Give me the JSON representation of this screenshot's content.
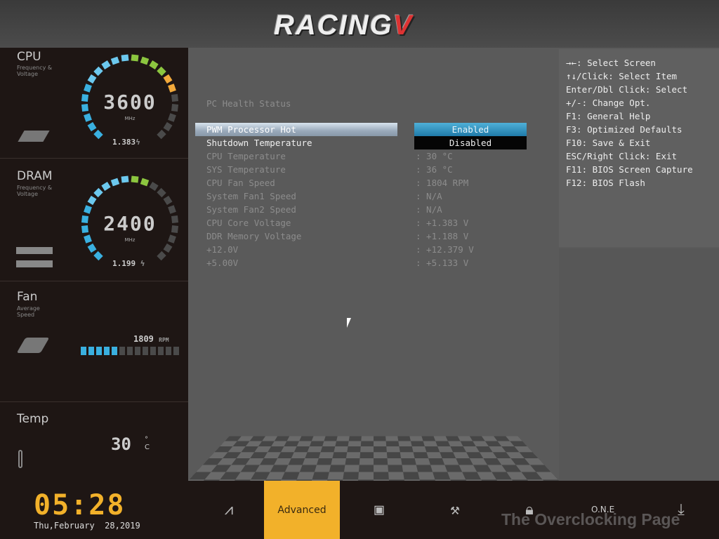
{
  "header": {
    "logo": "RACING",
    "logo_mark": "V"
  },
  "sidebar": {
    "cpu": {
      "title": "CPU",
      "subtitle": "Frequency & Voltage",
      "value": "3600",
      "unit": "MHz",
      "voltage": "1.383",
      "gauge_level": 0.77,
      "gauge_colors": [
        "#3ab0e0",
        "#8cc63f",
        "#f2a93b"
      ]
    },
    "dram": {
      "title": "DRAM",
      "subtitle": "Frequency & Voltage",
      "value": "2400",
      "unit": "MHz",
      "voltage": "1.199",
      "gauge_level": 0.59
    },
    "fan": {
      "title": "Fan",
      "subtitle": "Average Speed",
      "value": "1809",
      "unit": "RPM",
      "bar_level": 0.385
    },
    "temp": {
      "title": "Temp",
      "value": "30",
      "unit": "°C"
    }
  },
  "main": {
    "section_title": "PC Health Status",
    "items": [
      {
        "label": "PWM Processor Hot",
        "value": ""
      },
      {
        "label": "Shutdown Temperature",
        "value": ""
      },
      {
        "label": "CPU Temperature",
        "value": ": 30 °C"
      },
      {
        "label": "SYS Temperature",
        "value": ": 36 °C"
      },
      {
        "label": "CPU Fan Speed",
        "value": ": 1804 RPM"
      },
      {
        "label": "System Fan1 Speed",
        "value": ": N/A"
      },
      {
        "label": "System Fan2 Speed",
        "value": ": N/A"
      },
      {
        "label": "CPU Core Voltage",
        "value": ": +1.383 V"
      },
      {
        "label": "DDR Memory Voltage",
        "value": ": +1.188 V"
      },
      {
        "label": "+12.0V",
        "value": ": +12.379 V"
      },
      {
        "label": "+5.00V",
        "value": ": +5.133 V"
      }
    ],
    "dropdown": {
      "options": [
        "Enabled",
        "Disabled"
      ],
      "selected": "Enabled"
    }
  },
  "help": [
    "→←: Select Screen",
    "↑↓/Click: Select Item",
    "Enter/Dbl Click: Select",
    "+/-: Change Opt.",
    "F1: General Help",
    "F3: Optimized Defaults",
    "F10: Save & Exit",
    "ESC/Right Click: Exit",
    "F11: BIOS Screen Capture",
    "F12: BIOS Flash"
  ],
  "bottom": {
    "time": "05:28",
    "date": "Thu,February  28,2019",
    "tabs": [
      {
        "name": "main",
        "icon": "chart-icon"
      },
      {
        "name": "Advanced",
        "label": "Advanced"
      },
      {
        "name": "chipset",
        "icon": "chip-icon"
      },
      {
        "name": "tools",
        "icon": "wrench-icon"
      },
      {
        "name": "security",
        "icon": "lock-icon"
      },
      {
        "name": "one",
        "label": "O.N.E"
      },
      {
        "name": "exit",
        "icon": "download-icon"
      }
    ],
    "watermark": "The Overclocking Page"
  },
  "colors": {
    "accent": "#f2b12a",
    "gauge_blue": "#3ab0e0",
    "gauge_green": "#8cc63f",
    "gauge_orange": "#f2a93b",
    "gauge_off": "#4a4a4a"
  }
}
